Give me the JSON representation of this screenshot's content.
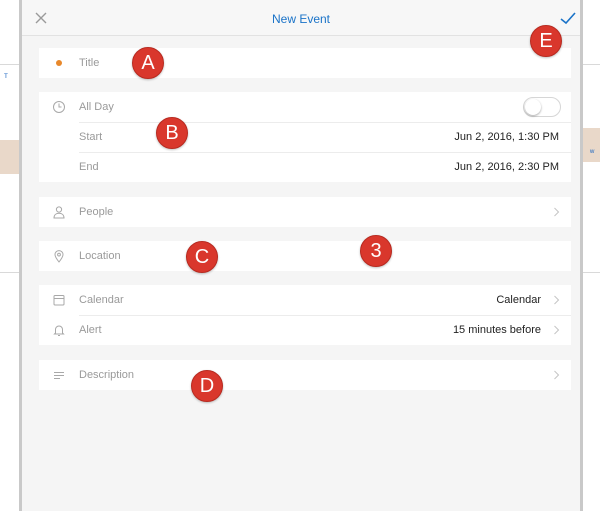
{
  "header": {
    "title": "New Event",
    "close_icon": "close-icon",
    "confirm_icon": "checkmark-icon"
  },
  "title_row": {
    "placeholder": "Title"
  },
  "datetime": {
    "all_day_label": "All Day",
    "all_day_enabled": false,
    "start_label": "Start",
    "start_value": "Jun 2, 2016, 1:30 PM",
    "end_label": "End",
    "end_value": "Jun 2, 2016, 2:30 PM"
  },
  "people": {
    "label": "People"
  },
  "location": {
    "label": "Location"
  },
  "calendar": {
    "label": "Calendar",
    "value": "Calendar"
  },
  "alert": {
    "label": "Alert",
    "value": "15 minutes before"
  },
  "description": {
    "label": "Description"
  },
  "annotations": [
    "A",
    "B",
    "C",
    "3",
    "D",
    "E"
  ],
  "colors": {
    "accent": "#1a73c8",
    "title_dot": "#e8882b",
    "badge": "#d9372c"
  }
}
